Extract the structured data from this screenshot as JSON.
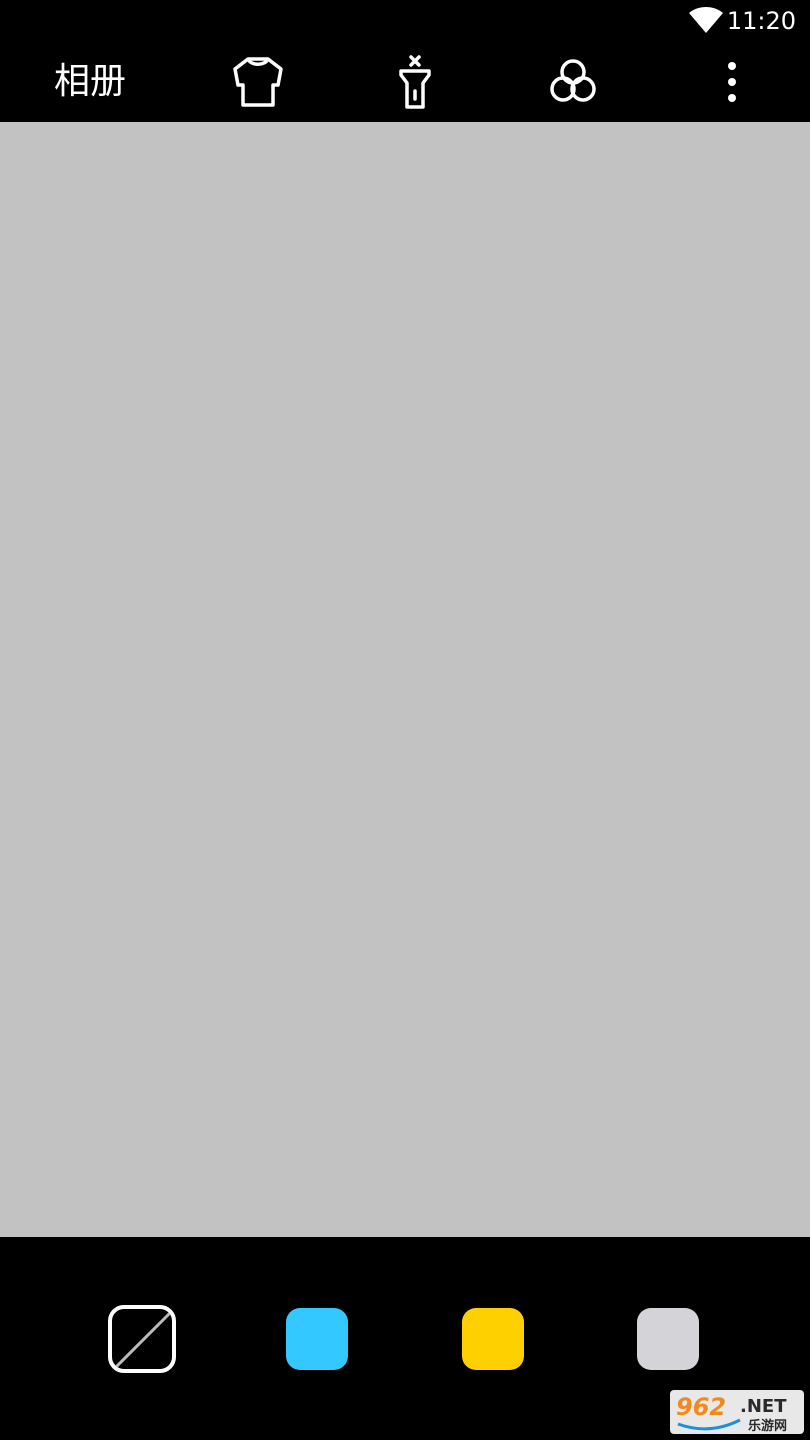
{
  "status_bar": {
    "time": "11:20",
    "wifi_icon": "wifi-icon"
  },
  "toolbar": {
    "album_label": "相册",
    "icons": [
      "shirt-icon",
      "flashlight-icon",
      "filter-circles-icon",
      "more-vertical-icon"
    ]
  },
  "palette": {
    "swatches": [
      {
        "name": "no-color",
        "color": "transparent"
      },
      {
        "name": "blue",
        "color": "#33c8ff"
      },
      {
        "name": "yellow",
        "color": "#ffd000"
      },
      {
        "name": "gray",
        "color": "#d4d4d8"
      }
    ],
    "selected": "no-color"
  },
  "colors": {
    "preview_background": "#c2c2c2",
    "bar_background": "#000000"
  },
  "watermark": {
    "brand": "962",
    "suffix": ".NET",
    "subtitle": "乐游网"
  }
}
